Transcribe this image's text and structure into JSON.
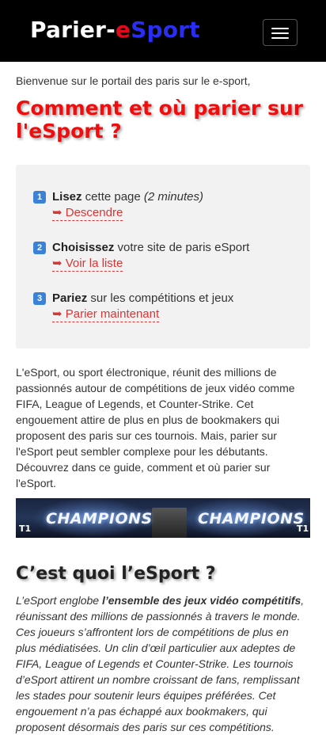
{
  "nav": {
    "logo_part1": "Parier-",
    "logo_part2": "e",
    "logo_part3": "Sport",
    "menu_icon": "hamburger-icon"
  },
  "welcome_text": "Bienvenue sur le portail des paris sur le e-sport,",
  "main_title": "Comment et où parier sur l'eSport ?",
  "steps": [
    {
      "number": "1",
      "bold": "Lisez",
      "text": " cette page ",
      "italic": "(2 minutes)",
      "arrow": "➥",
      "link": "Descendre"
    },
    {
      "number": "2",
      "bold": "Choisissez",
      "text": " votre site de paris eSport",
      "italic": "",
      "arrow": "➥",
      "link": "Voir la liste"
    },
    {
      "number": "3",
      "bold": "Pariez",
      "text": " sur les compétitions et jeux",
      "italic": "",
      "arrow": "➥",
      "link": "Parier maintenant"
    }
  ],
  "intro_text": "L'eSport, ou sport électronique, réunit des millions de passionnés autour de compétitions de jeux vidéo comme FIFA, League of Legends, et Counter-Strike. Cet engouement attire de plus en plus de bookmakers qui proposent des paris sur ces tournois. Mais, parier sur l'eSport peut sembler complexe pour les débutants. Découvrez dans ce guide, comment et où parier sur l'eSport.",
  "banner": {
    "word_left": "CHAMPIONS",
    "word_right": "CHAMPIONS",
    "tag_left": "T1",
    "tag_right": "T1"
  },
  "section_title": "C’est quoi l’eSport ?",
  "section_text": {
    "lead": "L’eSport englobe ",
    "bold": "l’ensemble des jeux vidéo compétitifs",
    "rest": ", réunissant des millions de passionnés à travers le monde. Ces joueurs s’affrontent lors de compétitions de plus en plus médiatisées. Un clin d’œil particulier aux adeptes de FIFA, League of Legends et Counter-Strike. Les tournois d’eSport attirent un nombre croissant de fans, remplissant les stades pour soutenir leurs équipes préférées. Cet engouement n’a pas échappé aux bookmakers, qui proposent désormais des paris sur ces compétitions."
  },
  "colors": {
    "logo_red": "#e1091b",
    "logo_blue": "#2a2df2",
    "title_red": "#f00d0d",
    "link_red": "#d93636",
    "badge_blue": "#3b82d6",
    "steps_bg": "#f2f2f2"
  }
}
